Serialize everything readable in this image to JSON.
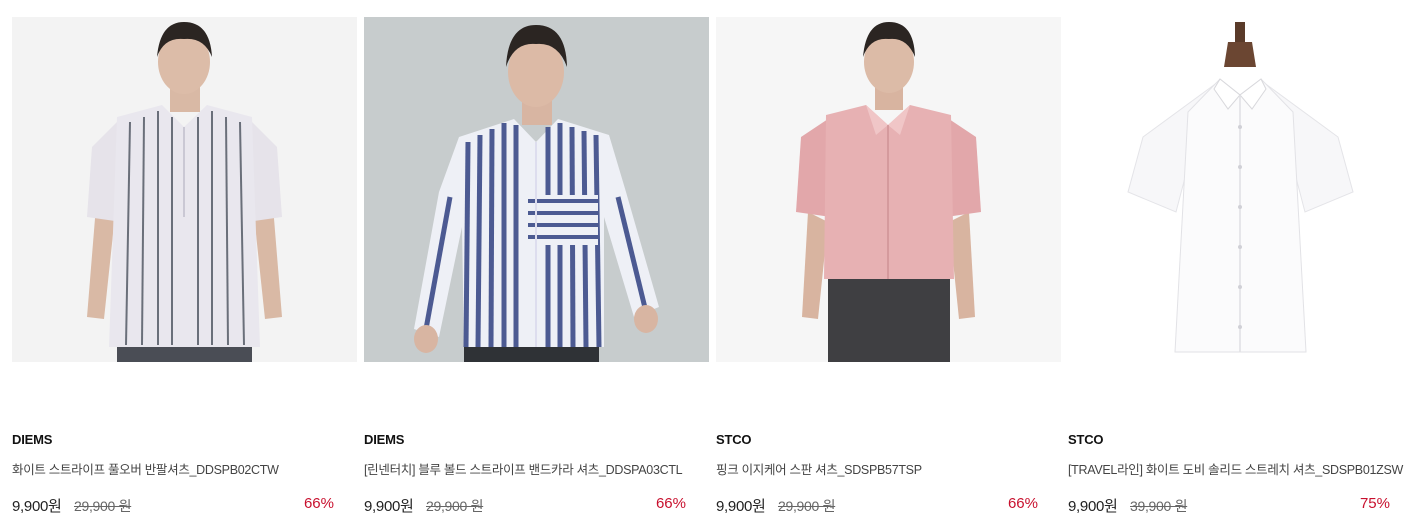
{
  "products": [
    {
      "brand": "DIEMS",
      "name": "화이트 스트라이프 풀오버 반팔셔츠_DDSPB02CTW",
      "price": "9,900원",
      "original_price": "29,900 원",
      "discount": "66%",
      "image_bg": "#f3f3f3"
    },
    {
      "brand": "DIEMS",
      "name": "[린넨터치] 블루 볼드 스트라이프 밴드카라 셔츠_DDSPA03CTL",
      "price": "9,900원",
      "original_price": "29,900 원",
      "discount": "66%",
      "image_bg": "#c7cccd"
    },
    {
      "brand": "STCO",
      "name": "핑크 이지케어 스판 셔츠_SDSPB57TSP",
      "price": "9,900원",
      "original_price": "29,900 원",
      "discount": "66%",
      "image_bg": "#f6f6f6"
    },
    {
      "brand": "STCO",
      "name": "[TRAVEL라인] 화이트 도비 솔리드 스트레치 셔츠_SDSPB01ZSW",
      "price": "9,900원",
      "original_price": "39,900 원",
      "discount": "75%",
      "image_bg": "#ffffff"
    }
  ],
  "colors": {
    "discount": "#c8102e",
    "text": "#222222"
  }
}
